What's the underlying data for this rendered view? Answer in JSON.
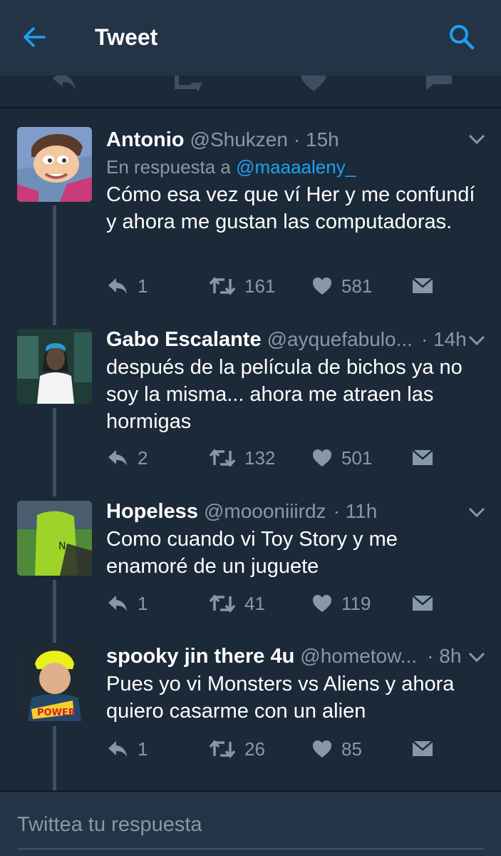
{
  "header": {
    "title": "Tweet",
    "back_icon": "arrow-left-icon",
    "search_icon": "search-icon",
    "accent": "#1da1f2"
  },
  "replies": [
    {
      "name": "Antonio",
      "handle": "@Shukzen",
      "time": "· 15h",
      "in_reply_prefix": "En respuesta a",
      "in_reply_mention": "@maaaaleny_",
      "text": "Cómo esa vez que ví Her y me confundí y ahora me gustan las computadoras.",
      "replies": "1",
      "retweets": "161",
      "likes": "581"
    },
    {
      "name": "Gabo Escalante",
      "handle": "@ayquefabulo...",
      "time": "· 14h",
      "text": "después de la película de bichos ya no soy la misma... ahora me atraen las hormigas",
      "replies": "2",
      "retweets": "132",
      "likes": "501"
    },
    {
      "name": "Hopeless",
      "handle": "@moooniiirdz",
      "time": "· 11h",
      "text": "Como cuando vi Toy Story y me enamoré de un juguete",
      "replies": "1",
      "retweets": "41",
      "likes": "119"
    },
    {
      "name": "spooky jin there 4u",
      "handle": "@hometow...",
      "time": "· 8h",
      "text": "Pues yo vi Monsters vs Aliens y ahora quiero casarme con un alien",
      "replies": "1",
      "retweets": "26",
      "likes": "85"
    }
  ],
  "compose": {
    "placeholder": "Twittea tu respuesta"
  }
}
